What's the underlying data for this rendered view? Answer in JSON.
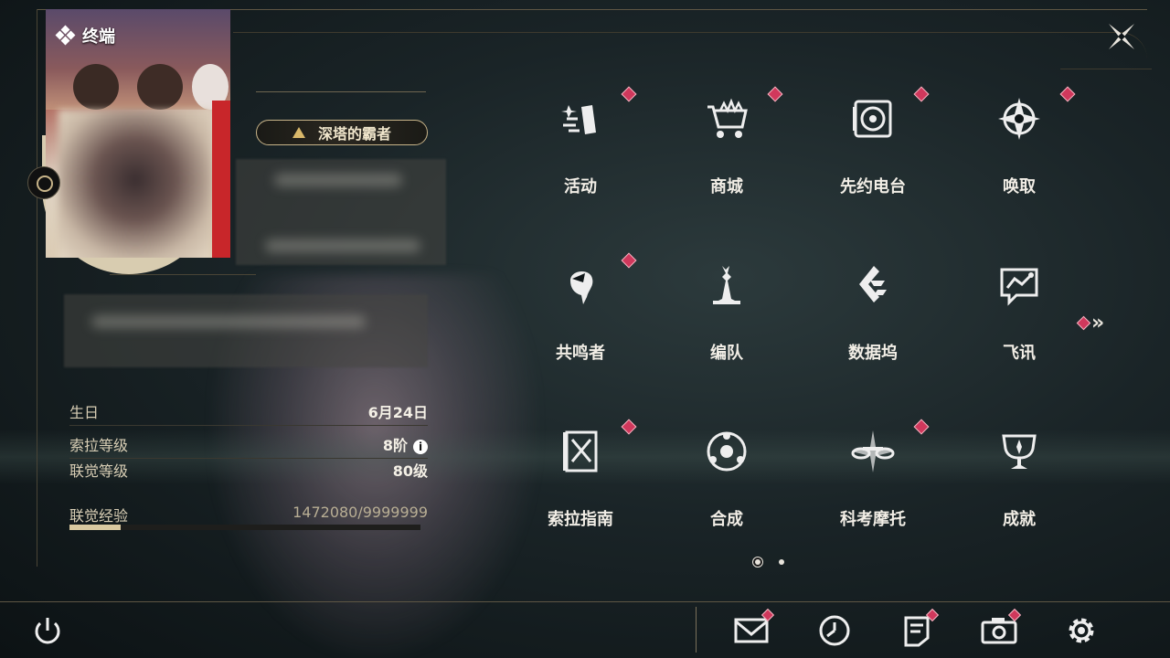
{
  "header": {
    "title": "终端"
  },
  "profile": {
    "rank_title": "深塔的霸者"
  },
  "info": {
    "birthday_label": "生日",
    "birthday_value": "6月24日",
    "sola_level_label": "索拉等级",
    "sola_level_value": "8阶",
    "info_icon_glyph": "i",
    "union_level_label": "联觉等级",
    "union_level_value": "80级",
    "exp_label": "联觉经验",
    "exp_value": "1472080/9999999",
    "exp_fraction": 0.147
  },
  "grid": {
    "items": [
      {
        "label": "活动",
        "icon": "event-icon",
        "badge": true
      },
      {
        "label": "商城",
        "icon": "shop-icon",
        "badge": true
      },
      {
        "label": "先约电台",
        "icon": "radio-icon",
        "badge": true
      },
      {
        "label": "唤取",
        "icon": "convene-icon",
        "badge": true
      },
      {
        "label": "共鸣者",
        "icon": "resonator-icon",
        "badge": true
      },
      {
        "label": "编队",
        "icon": "team-icon",
        "badge": false
      },
      {
        "label": "数据坞",
        "icon": "data-bank-icon",
        "badge": false
      },
      {
        "label": "飞讯",
        "icon": "message-icon",
        "badge": false
      },
      {
        "label": "索拉指南",
        "icon": "guidebook-icon",
        "badge": true
      },
      {
        "label": "合成",
        "icon": "synthesis-icon",
        "badge": false
      },
      {
        "label": "科考摩托",
        "icon": "motorcycle-icon",
        "badge": true
      },
      {
        "label": "成就",
        "icon": "achievement-icon",
        "badge": false
      }
    ],
    "next_page_glyph": "»",
    "pages": 2,
    "current_page": 1
  },
  "bottom_bar": {
    "buttons": [
      {
        "icon": "power-icon"
      },
      {
        "icon": "mail-icon"
      },
      {
        "icon": "clock-icon"
      },
      {
        "icon": "notes-icon"
      },
      {
        "icon": "camera-icon"
      },
      {
        "icon": "settings-icon"
      }
    ]
  },
  "colors": {
    "accent": "#c8b489",
    "badge": "#d0385c",
    "text": "#e8e4dc"
  }
}
